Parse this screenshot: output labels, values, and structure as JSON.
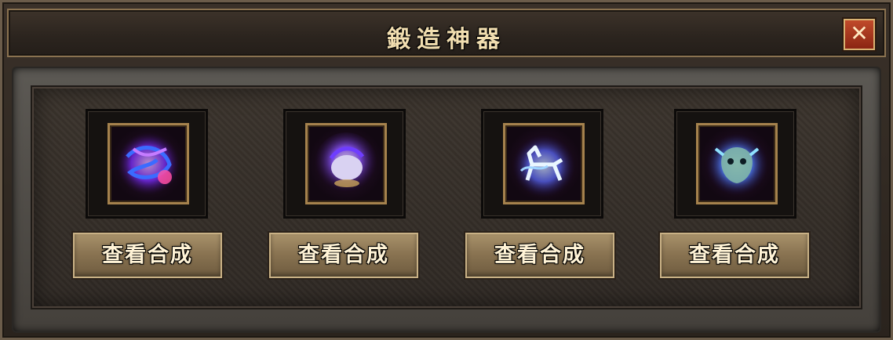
{
  "window": {
    "title": "鍛造神器",
    "close_label": "✕"
  },
  "items": [
    {
      "icon": "purple-scarf-artifact-icon",
      "button_label": "查看合成"
    },
    {
      "icon": "purple-orb-artifact-icon",
      "button_label": "查看合成"
    },
    {
      "icon": "blue-spirit-horse-artifact-icon",
      "button_label": "查看合成"
    },
    {
      "icon": "jade-beast-mask-artifact-icon",
      "button_label": "查看合成"
    }
  ],
  "colors": {
    "title_text": "#f1deb0",
    "button_face": "#8a7452",
    "item_border": "#a5824d",
    "close_button": "#b0401f"
  }
}
